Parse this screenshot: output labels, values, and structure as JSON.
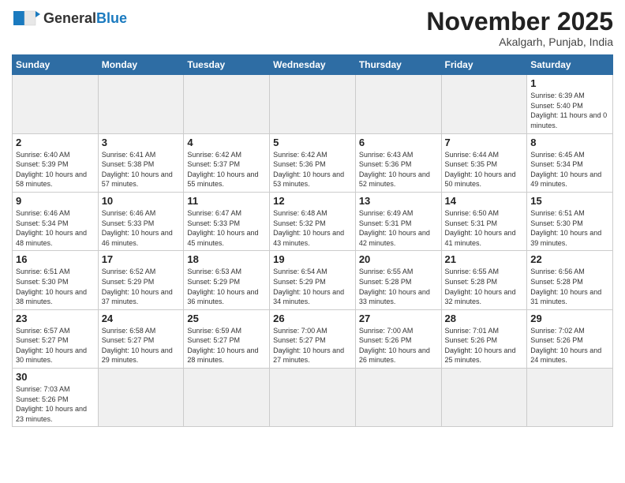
{
  "header": {
    "logo_general": "General",
    "logo_blue": "Blue",
    "month_title": "November 2025",
    "location": "Akalgarh, Punjab, India"
  },
  "days_of_week": [
    "Sunday",
    "Monday",
    "Tuesday",
    "Wednesday",
    "Thursday",
    "Friday",
    "Saturday"
  ],
  "weeks": [
    [
      {
        "day": null,
        "info": ""
      },
      {
        "day": null,
        "info": ""
      },
      {
        "day": null,
        "info": ""
      },
      {
        "day": null,
        "info": ""
      },
      {
        "day": null,
        "info": ""
      },
      {
        "day": null,
        "info": ""
      },
      {
        "day": "1",
        "info": "Sunrise: 6:39 AM\nSunset: 5:40 PM\nDaylight: 11 hours and 0 minutes."
      }
    ],
    [
      {
        "day": "2",
        "info": "Sunrise: 6:40 AM\nSunset: 5:39 PM\nDaylight: 10 hours and 58 minutes."
      },
      {
        "day": "3",
        "info": "Sunrise: 6:41 AM\nSunset: 5:38 PM\nDaylight: 10 hours and 57 minutes."
      },
      {
        "day": "4",
        "info": "Sunrise: 6:42 AM\nSunset: 5:37 PM\nDaylight: 10 hours and 55 minutes."
      },
      {
        "day": "5",
        "info": "Sunrise: 6:42 AM\nSunset: 5:36 PM\nDaylight: 10 hours and 53 minutes."
      },
      {
        "day": "6",
        "info": "Sunrise: 6:43 AM\nSunset: 5:36 PM\nDaylight: 10 hours and 52 minutes."
      },
      {
        "day": "7",
        "info": "Sunrise: 6:44 AM\nSunset: 5:35 PM\nDaylight: 10 hours and 50 minutes."
      },
      {
        "day": "8",
        "info": "Sunrise: 6:45 AM\nSunset: 5:34 PM\nDaylight: 10 hours and 49 minutes."
      }
    ],
    [
      {
        "day": "9",
        "info": "Sunrise: 6:46 AM\nSunset: 5:34 PM\nDaylight: 10 hours and 48 minutes."
      },
      {
        "day": "10",
        "info": "Sunrise: 6:46 AM\nSunset: 5:33 PM\nDaylight: 10 hours and 46 minutes."
      },
      {
        "day": "11",
        "info": "Sunrise: 6:47 AM\nSunset: 5:33 PM\nDaylight: 10 hours and 45 minutes."
      },
      {
        "day": "12",
        "info": "Sunrise: 6:48 AM\nSunset: 5:32 PM\nDaylight: 10 hours and 43 minutes."
      },
      {
        "day": "13",
        "info": "Sunrise: 6:49 AM\nSunset: 5:31 PM\nDaylight: 10 hours and 42 minutes."
      },
      {
        "day": "14",
        "info": "Sunrise: 6:50 AM\nSunset: 5:31 PM\nDaylight: 10 hours and 41 minutes."
      },
      {
        "day": "15",
        "info": "Sunrise: 6:51 AM\nSunset: 5:30 PM\nDaylight: 10 hours and 39 minutes."
      }
    ],
    [
      {
        "day": "16",
        "info": "Sunrise: 6:51 AM\nSunset: 5:30 PM\nDaylight: 10 hours and 38 minutes."
      },
      {
        "day": "17",
        "info": "Sunrise: 6:52 AM\nSunset: 5:29 PM\nDaylight: 10 hours and 37 minutes."
      },
      {
        "day": "18",
        "info": "Sunrise: 6:53 AM\nSunset: 5:29 PM\nDaylight: 10 hours and 36 minutes."
      },
      {
        "day": "19",
        "info": "Sunrise: 6:54 AM\nSunset: 5:29 PM\nDaylight: 10 hours and 34 minutes."
      },
      {
        "day": "20",
        "info": "Sunrise: 6:55 AM\nSunset: 5:28 PM\nDaylight: 10 hours and 33 minutes."
      },
      {
        "day": "21",
        "info": "Sunrise: 6:55 AM\nSunset: 5:28 PM\nDaylight: 10 hours and 32 minutes."
      },
      {
        "day": "22",
        "info": "Sunrise: 6:56 AM\nSunset: 5:28 PM\nDaylight: 10 hours and 31 minutes."
      }
    ],
    [
      {
        "day": "23",
        "info": "Sunrise: 6:57 AM\nSunset: 5:27 PM\nDaylight: 10 hours and 30 minutes."
      },
      {
        "day": "24",
        "info": "Sunrise: 6:58 AM\nSunset: 5:27 PM\nDaylight: 10 hours and 29 minutes."
      },
      {
        "day": "25",
        "info": "Sunrise: 6:59 AM\nSunset: 5:27 PM\nDaylight: 10 hours and 28 minutes."
      },
      {
        "day": "26",
        "info": "Sunrise: 7:00 AM\nSunset: 5:27 PM\nDaylight: 10 hours and 27 minutes."
      },
      {
        "day": "27",
        "info": "Sunrise: 7:00 AM\nSunset: 5:26 PM\nDaylight: 10 hours and 26 minutes."
      },
      {
        "day": "28",
        "info": "Sunrise: 7:01 AM\nSunset: 5:26 PM\nDaylight: 10 hours and 25 minutes."
      },
      {
        "day": "29",
        "info": "Sunrise: 7:02 AM\nSunset: 5:26 PM\nDaylight: 10 hours and 24 minutes."
      }
    ],
    [
      {
        "day": "30",
        "info": "Sunrise: 7:03 AM\nSunset: 5:26 PM\nDaylight: 10 hours and 23 minutes."
      },
      {
        "day": null,
        "info": ""
      },
      {
        "day": null,
        "info": ""
      },
      {
        "day": null,
        "info": ""
      },
      {
        "day": null,
        "info": ""
      },
      {
        "day": null,
        "info": ""
      },
      {
        "day": null,
        "info": ""
      }
    ]
  ]
}
